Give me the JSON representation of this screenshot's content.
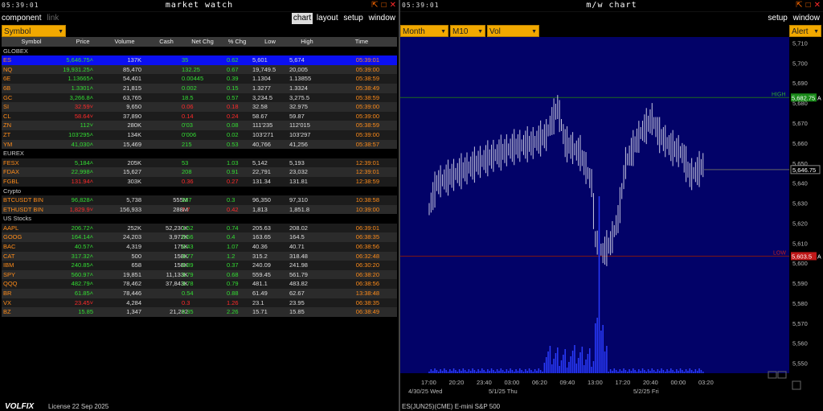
{
  "left": {
    "clock": "05:39:01",
    "title": "market watch",
    "menu": [
      "component",
      "link"
    ],
    "menu_right": [
      "chart",
      "layout",
      "setup",
      "window"
    ],
    "symbol_dropdown": "Symbol"
  },
  "right": {
    "clock": "05:39:01",
    "title": "m/w chart",
    "menu_right": [
      "setup",
      "window"
    ],
    "dropdowns": [
      "Month",
      "M10",
      "Vol"
    ],
    "alert": "Alert"
  },
  "columns": [
    "Symbol",
    "Price",
    "Volume",
    "Cash",
    "Net Chg",
    "% Chg",
    "Low",
    "High",
    "Time"
  ],
  "rows": [
    {
      "g": "GLOBEX"
    },
    {
      "s": "ES",
      "p": "5,646.75˄",
      "v": "137K",
      "c": "",
      "n": "35",
      "pc": "0.62",
      "l": "5,601",
      "h": "5,674",
      "t": "05:39:01",
      "d": "up",
      "sel": true
    },
    {
      "s": "NQ",
      "p": "19,931.25˄",
      "v": "85,470",
      "c": "",
      "n": "132.25",
      "pc": "0.67",
      "l": "19,749.5",
      "h": "20,005",
      "t": "05:39:00",
      "d": "up"
    },
    {
      "s": "6E",
      "p": "1.13665˄",
      "v": "54,401",
      "c": "",
      "n": "0.00445",
      "pc": "0.39",
      "l": "1.1304",
      "h": "1.13855",
      "t": "05:38:59",
      "d": "up"
    },
    {
      "s": "6B",
      "p": "1.3301˄",
      "v": "21,815",
      "c": "",
      "n": "0.002",
      "pc": "0.15",
      "l": "1.3277",
      "h": "1.3324",
      "t": "05:38:49",
      "d": "up"
    },
    {
      "s": "GC",
      "p": "3,266.8˄",
      "v": "63,765",
      "c": "",
      "n": "18.5",
      "pc": "0.57",
      "l": "3,234.5",
      "h": "3,275.5",
      "t": "05:38:59",
      "d": "up"
    },
    {
      "s": "SI",
      "p": "32.59˅",
      "v": "9,650",
      "c": "",
      "n": "0.06",
      "pc": "0.18",
      "l": "32.58",
      "h": "32.975",
      "t": "05:39:00",
      "d": "dn"
    },
    {
      "s": "CL",
      "p": "58.64˅",
      "v": "37,890",
      "c": "",
      "n": "0.14",
      "pc": "0.24",
      "l": "58.67",
      "h": "59.87",
      "t": "05:39:00",
      "d": "dn"
    },
    {
      "s": "ZN",
      "p": "112˅",
      "v": "280K",
      "c": "",
      "n": "0'03",
      "pc": "0.08",
      "l": "111'235",
      "h": "112'015",
      "t": "05:38:59",
      "d": "up"
    },
    {
      "s": "ZT",
      "p": "103'295˄",
      "v": "134K",
      "c": "",
      "n": "0'006",
      "pc": "0.02",
      "l": "103'271",
      "h": "103'297",
      "t": "05:39:00",
      "d": "up"
    },
    {
      "s": "YM",
      "p": "41,030˄",
      "v": "15,469",
      "c": "",
      "n": "215",
      "pc": "0.53",
      "l": "40,766",
      "h": "41,256",
      "t": "05:38:57",
      "d": "up"
    },
    {
      "g": "EUREX"
    },
    {
      "s": "FESX",
      "p": "5,184˄",
      "v": "205K",
      "c": "",
      "n": "53",
      "pc": "1.03",
      "l": "5,142",
      "h": "5,193",
      "t": "12:39:01",
      "d": "up"
    },
    {
      "s": "FDAX",
      "p": "22,998˄",
      "v": "15,627",
      "c": "",
      "n": "208",
      "pc": "0.91",
      "l": "22,791",
      "h": "23,032",
      "t": "12:39:01",
      "d": "up"
    },
    {
      "s": "FGBL",
      "p": "131.94˄",
      "v": "303K",
      "c": "",
      "n": "0.36",
      "pc": "0.27",
      "l": "131.34",
      "h": "131.81",
      "t": "12:38:59",
      "d": "dn"
    },
    {
      "g": "Crypto"
    },
    {
      "s": "BTCUSDT BIN",
      "p": "96,828˄",
      "v": "5,738",
      "c": "555M",
      "n": "287",
      "pc": "0.3",
      "l": "96,350",
      "h": "97,310",
      "t": "10:38:58",
      "d": "up"
    },
    {
      "s": "ETHUSDT BIN",
      "p": "1,829.9˅",
      "v": "156,933",
      "c": "288M",
      "n": "7.7",
      "pc": "0.42",
      "l": "1,813",
      "h": "1,851.8",
      "t": "10:39:00",
      "d": "dn"
    },
    {
      "g": "US Stocks"
    },
    {
      "s": "AAPL",
      "p": "206.72˄",
      "v": "252K",
      "c": "52,230K",
      "n": "1.52",
      "pc": "0.74",
      "l": "205.63",
      "h": "208.02",
      "t": "06:39:01",
      "d": "up"
    },
    {
      "s": "GOOG",
      "p": "164.14˄",
      "v": "24,203",
      "c": "3,972K",
      "n": "0.66",
      "pc": "0.4",
      "l": "163.65",
      "h": "164.5",
      "t": "06:38:35",
      "d": "up"
    },
    {
      "s": "BAC",
      "p": "40.57˄",
      "v": "4,319",
      "c": "175K",
      "n": "0.43",
      "pc": "1.07",
      "l": "40.36",
      "h": "40.71",
      "t": "06:38:56",
      "d": "up"
    },
    {
      "s": "CAT",
      "p": "317.32˄",
      "v": "500",
      "c": "158K",
      "n": "3.77",
      "pc": "1.2",
      "l": "315.2",
      "h": "318.48",
      "t": "06:32:48",
      "d": "up"
    },
    {
      "s": "IBM",
      "p": "240.85˄",
      "v": "658",
      "c": "158K",
      "n": "0.89",
      "pc": "0.37",
      "l": "240.09",
      "h": "241.98",
      "t": "06:30:20",
      "d": "up"
    },
    {
      "s": "SPY",
      "p": "560.97˄",
      "v": "19,851",
      "c": "11,133K",
      "n": "3.79",
      "pc": "0.68",
      "l": "559.45",
      "h": "561.79",
      "t": "06:38:20",
      "d": "up"
    },
    {
      "s": "QQQ",
      "p": "482.79˄",
      "v": "78,462",
      "c": "37,843K",
      "n": "3.78",
      "pc": "0.79",
      "l": "481.1",
      "h": "483.82",
      "t": "06:38:56",
      "d": "up"
    },
    {
      "s": "BR",
      "p": "61.85˄",
      "v": "78,446",
      "c": "",
      "n": "0.54",
      "pc": "0.88",
      "l": "61.49",
      "h": "62.67",
      "t": "13:38:48",
      "d": "up"
    },
    {
      "s": "VX",
      "p": "23.45˅",
      "v": "4,284",
      "c": "",
      "n": "0.3",
      "pc": "1.26",
      "l": "23.1",
      "h": "23.95",
      "t": "06:38:35",
      "d": "dn"
    },
    {
      "s": "BZ",
      "p": "15.85",
      "v": "1,347",
      "c": "21,282",
      "n": "0.35",
      "pc": "2.26",
      "l": "15.71",
      "h": "15.85",
      "t": "06:38:49",
      "d": "up"
    }
  ],
  "chart_data": {
    "type": "bar",
    "yticks": [
      "5,710",
      "5,700",
      "5,690",
      "5,680",
      "5,670",
      "5,660",
      "5,650",
      "5,640",
      "5,630",
      "5,620",
      "5,610",
      "5,600",
      "5,590",
      "5,580",
      "5,570",
      "5,560",
      "5,550"
    ],
    "ylim": [
      5545,
      5713
    ],
    "xticks": [
      "17:00",
      "20:20",
      "23:40",
      "03:00",
      "06:20",
      "09:40",
      "13:00",
      "17:20",
      "20:40",
      "00:00",
      "03:20"
    ],
    "dates": [
      "4/30/25 Wed",
      "5/1/25 Thu",
      "5/2/25 Fri"
    ],
    "high_label": "HIGH",
    "high_value": "5,682.75",
    "low_label": "LOW",
    "low_value": "5,603.5",
    "last": "5,646.75"
  },
  "footer": {
    "logo": "VOLFIX",
    "license": "License 22 Sep 2025",
    "instrument": "ES(JUN25)(CME) E-mini S&P 500"
  }
}
